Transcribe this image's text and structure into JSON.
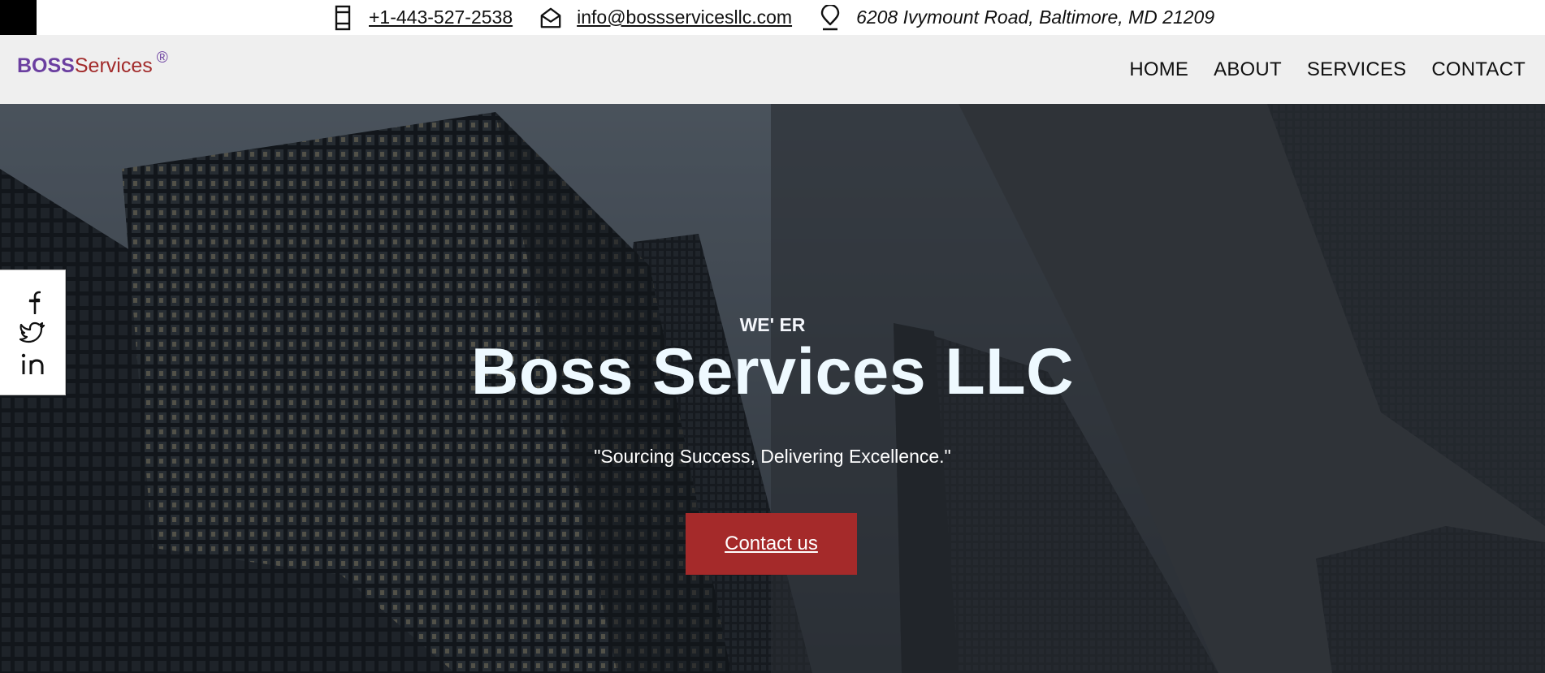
{
  "topbar": {
    "phone": "+1-443-527-2538",
    "email": "info@bossservicesllc.com",
    "address": "6208 Ivymount Road, Baltimore, MD 21209",
    "icons": [
      "phone-icon",
      "envelope-icon",
      "location-pin-icon"
    ]
  },
  "navbar": {
    "logo": {
      "bold": "BOSS",
      "rest": "Services",
      "reg": "®"
    },
    "links": [
      "HOME",
      "ABOUT",
      "SERVICES",
      "CONTACT"
    ]
  },
  "hero": {
    "kicker": "WE' ER",
    "title": "Boss Services LLC",
    "tagline": "\"Sourcing Success, Delivering Excellence.\"",
    "cta_label": "Contact us"
  },
  "social": {
    "icons": [
      "facebook-icon",
      "twitter-icon",
      "linkedin-icon"
    ]
  },
  "colors": {
    "brand_purple": "#6b3fa0",
    "brand_red": "#a22b2b",
    "cta_background": "#a52a2a",
    "nav_background": "#efefef",
    "hero_overlay": "#2b2e33"
  }
}
